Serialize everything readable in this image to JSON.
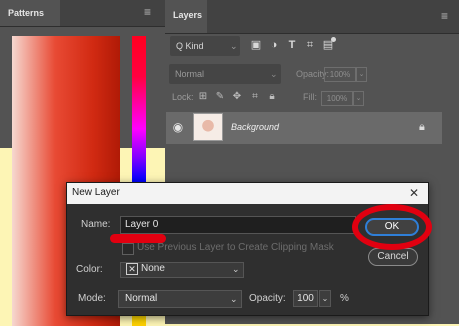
{
  "patterns_panel": {
    "tab_label": "Patterns",
    "menu_icon": "hamburger-icon"
  },
  "layers_panel": {
    "tab_label": "Layers",
    "menu_icon": "hamburger-icon",
    "filter": {
      "kind_label": "Q Kind",
      "icons": [
        "image-filter-icon",
        "adjustment-filter-icon",
        "type-filter-icon",
        "shape-filter-icon",
        "smart-object-filter-icon",
        "toggle-dot-icon"
      ]
    },
    "blend_mode": "Normal",
    "opacity_label": "Opacity:",
    "opacity_value": "100%",
    "lock_label": "Lock:",
    "fill_label": "Fill:",
    "fill_value": "100%",
    "layers": [
      {
        "name": "Background",
        "visible": true,
        "locked": true
      }
    ]
  },
  "dialog": {
    "title": "New Layer",
    "close_glyph": "✕",
    "name_label": "Name:",
    "name_value": "Layer 0",
    "clip_label": "Use Previous Layer to Create Clipping Mask",
    "color_label": "Color:",
    "color_value": "None",
    "mode_label": "Mode:",
    "mode_value": "Normal",
    "opacity_label": "Opacity:",
    "opacity_value": "100",
    "opacity_unit": "%",
    "ok_label": "OK",
    "cancel_label": "Cancel"
  },
  "colors": {
    "annotation_red": "#e10010",
    "ok_focus_blue": "#2f7fd8",
    "background_yellow": "#fdf5b5"
  }
}
